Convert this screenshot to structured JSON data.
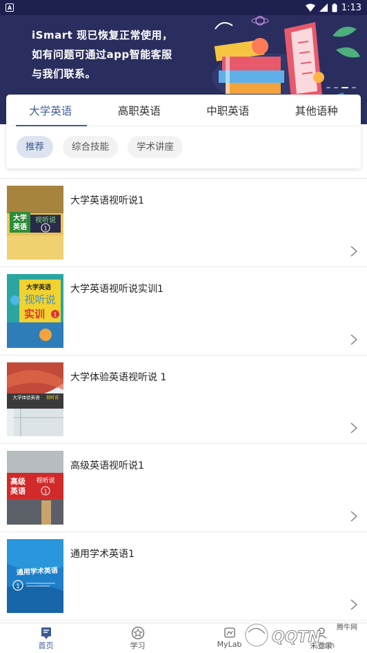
{
  "status_bar": {
    "time": "1:13",
    "app_indicator": "A"
  },
  "banner": {
    "lines": [
      "iSmart 现已恢复正常使用，",
      "如有问题可通过app智能客服",
      "与我们联系。"
    ],
    "slide_count": 4,
    "active_slide": 3
  },
  "tabs": [
    {
      "label": "大学英语",
      "active": true
    },
    {
      "label": "高职英语",
      "active": false
    },
    {
      "label": "中职英语",
      "active": false
    },
    {
      "label": "其他语种",
      "active": false
    }
  ],
  "chips": [
    {
      "label": "推荐",
      "active": true
    },
    {
      "label": "综合技能",
      "active": false
    },
    {
      "label": "学术讲座",
      "active": false
    }
  ],
  "courses": [
    {
      "title": "大学英语视听说1",
      "cover_lines": [
        "大学",
        "英语",
        "视听说",
        "1"
      ]
    },
    {
      "title": "大学英语视听说实训1",
      "cover_lines": [
        "大学英语",
        "视听说",
        "实训",
        "1"
      ]
    },
    {
      "title": "大学体验英语视听说 1",
      "cover_lines": [
        "大学体验英语",
        "视听说"
      ]
    },
    {
      "title": "高级英语视听说1",
      "cover_lines": [
        "高级",
        "英语",
        "视听说",
        "1"
      ]
    },
    {
      "title": "通用学术英语1",
      "cover_lines": [
        "通用学术英语",
        "1"
      ]
    }
  ],
  "bottom_nav": [
    {
      "label": "首页",
      "icon": "home-icon",
      "active": true
    },
    {
      "label": "学习",
      "icon": "star-circle-icon",
      "active": false
    },
    {
      "label": "MyLab",
      "icon": "mylab-icon",
      "active": false
    },
    {
      "label": "未登录",
      "icon": "user-icon",
      "active": false
    }
  ],
  "watermark": {
    "text": "QQTN",
    "suffix": ".com",
    "brand": "腾牛网"
  },
  "colors": {
    "accent": "#3b5b95",
    "banner_bg": "#2a2e5e",
    "status_bg": "#1e2150"
  }
}
